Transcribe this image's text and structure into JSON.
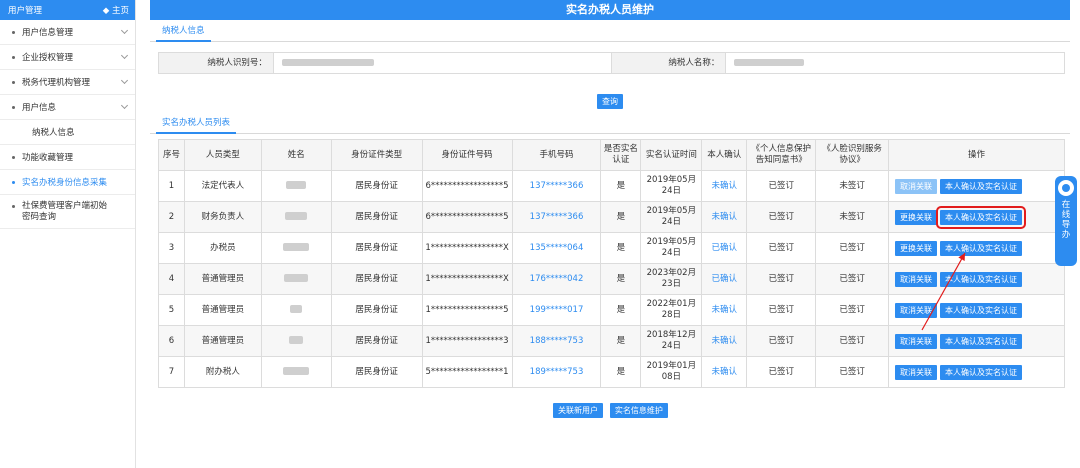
{
  "sidebar": {
    "header_title": "用户管理",
    "home_label": "◆ 主页",
    "items": [
      {
        "label": "用户信息管理",
        "has_chevron": true
      },
      {
        "label": "企业授权管理",
        "has_chevron": true
      },
      {
        "label": "税务代理机构管理",
        "has_chevron": true
      },
      {
        "label": "用户信息",
        "has_chevron": true
      },
      {
        "label": "纳税人信息",
        "sub": true
      },
      {
        "label": "功能收藏管理"
      },
      {
        "label": "实名办税身份信息采集",
        "active": true
      },
      {
        "label": "社保费管理客户端初始密码查询"
      }
    ]
  },
  "page": {
    "title": "实名办税人员维护",
    "tab_info": "纳税人信息",
    "tab_list": "实名办税人员列表",
    "id_label": "纳税人识别号：",
    "name_label": "纳税人名称：",
    "query_button": "查询"
  },
  "table": {
    "headers": [
      "序号",
      "人员类型",
      "姓名",
      "身份证件类型",
      "身份证件号码",
      "手机号码",
      "是否实名认证",
      "实名认证时间",
      "本人确认",
      "《个人信息保护告知同意书》",
      "《人脸识别服务协议》",
      "操作"
    ],
    "rows": [
      {
        "no": "1",
        "type": "法定代表人",
        "id_type": "居民身份证",
        "id_no": "6*****************5",
        "phone": "137*****366",
        "verified": "是",
        "time": "2019年05月24日",
        "confirm": "未确认",
        "privacy": "已签订",
        "face": "未签订",
        "op1": "取消关联",
        "op1_disabled": true,
        "op2": "本人确认及实名认证"
      },
      {
        "no": "2",
        "type": "财务负责人",
        "id_type": "居民身份证",
        "id_no": "6*****************5",
        "phone": "137*****366",
        "verified": "是",
        "time": "2019年05月24日",
        "confirm": "未确认",
        "privacy": "已签订",
        "face": "未签订",
        "op1": "更换关联",
        "op2": "本人确认及实名认证",
        "highlight": true
      },
      {
        "no": "3",
        "type": "办税员",
        "id_type": "居民身份证",
        "id_no": "1*****************X",
        "phone": "135*****064",
        "verified": "是",
        "time": "2019年05月24日",
        "confirm": "已确认",
        "privacy": "已签订",
        "face": "已签订",
        "op1": "更换关联",
        "op2": "本人确认及实名认证"
      },
      {
        "no": "4",
        "type": "普通管理员",
        "id_type": "居民身份证",
        "id_no": "1*****************X",
        "phone": "176*****042",
        "verified": "是",
        "time": "2023年02月23日",
        "confirm": "已确认",
        "privacy": "已签订",
        "face": "已签订",
        "op1": "取消关联",
        "op2": "本人确认及实名认证"
      },
      {
        "no": "5",
        "type": "普通管理员",
        "id_type": "居民身份证",
        "id_no": "1*****************5",
        "phone": "199*****017",
        "verified": "是",
        "time": "2022年01月28日",
        "confirm": "未确认",
        "privacy": "已签订",
        "face": "已签订",
        "op1": "取消关联",
        "op2": "本人确认及实名认证"
      },
      {
        "no": "6",
        "type": "普通管理员",
        "id_type": "居民身份证",
        "id_no": "1*****************3",
        "phone": "188*****753",
        "verified": "是",
        "time": "2018年12月24日",
        "confirm": "未确认",
        "privacy": "已签订",
        "face": "已签订",
        "op1": "取消关联",
        "op2": "本人确认及实名认证"
      },
      {
        "no": "7",
        "type": "附办税人",
        "id_type": "居民身份证",
        "id_no": "5*****************1",
        "phone": "189*****753",
        "verified": "是",
        "time": "2019年01月08日",
        "confirm": "未确认",
        "privacy": "已签订",
        "face": "已签订",
        "op1": "取消关联",
        "op2": "本人确认及实名认证"
      }
    ]
  },
  "bottom": {
    "add_user": "关联新用户",
    "maintain": "实名信息维护"
  },
  "guide": {
    "label": "在线导办"
  },
  "colors": {
    "accent": "#2d8cf0",
    "highlight": "#e21c1c"
  }
}
